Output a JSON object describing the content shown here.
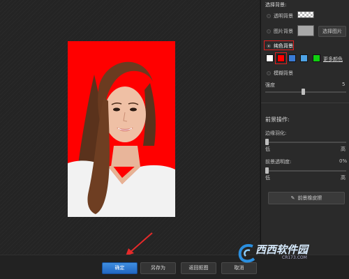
{
  "background_section": {
    "title": "选择背景:",
    "transparent_label": "透明背景",
    "image_label": "图片背景",
    "choose_image_button": "选择图片",
    "solid_label": "纯色背景",
    "more_colors_link": "更多颜色",
    "blur_label": "模糊背景",
    "blur_amount_label": "强度",
    "blur_amount_value": "5"
  },
  "swatches": [
    {
      "name": "white",
      "color": "#ffffff"
    },
    {
      "name": "red",
      "color": "#ff0000",
      "selected": true
    },
    {
      "name": "blue",
      "color": "#3a7bd5"
    },
    {
      "name": "light-blue",
      "color": "#4ea3e6"
    },
    {
      "name": "green",
      "color": "#10d010"
    }
  ],
  "foreground_section": {
    "title": "前景操作:",
    "feather_label": "边缘羽化:",
    "feather_low": "低",
    "feather_high": "高",
    "opacity_label": "前景透明度:",
    "opacity_value": "0%",
    "opacity_low": "低",
    "opacity_high": "高",
    "fg_eraser_button": "前景橡皮擦"
  },
  "bottom_bar": {
    "confirm_button": "确定",
    "save_as_button": "另存为",
    "back_button": "返回抠图",
    "cancel_button": "取消"
  },
  "watermark": {
    "brand": "西西软件园",
    "domain": "CR173.COM"
  },
  "colors": {
    "accent_blue": "#2a78d6",
    "highlight_red": "#e02020",
    "photo_background": "#ff0000"
  }
}
